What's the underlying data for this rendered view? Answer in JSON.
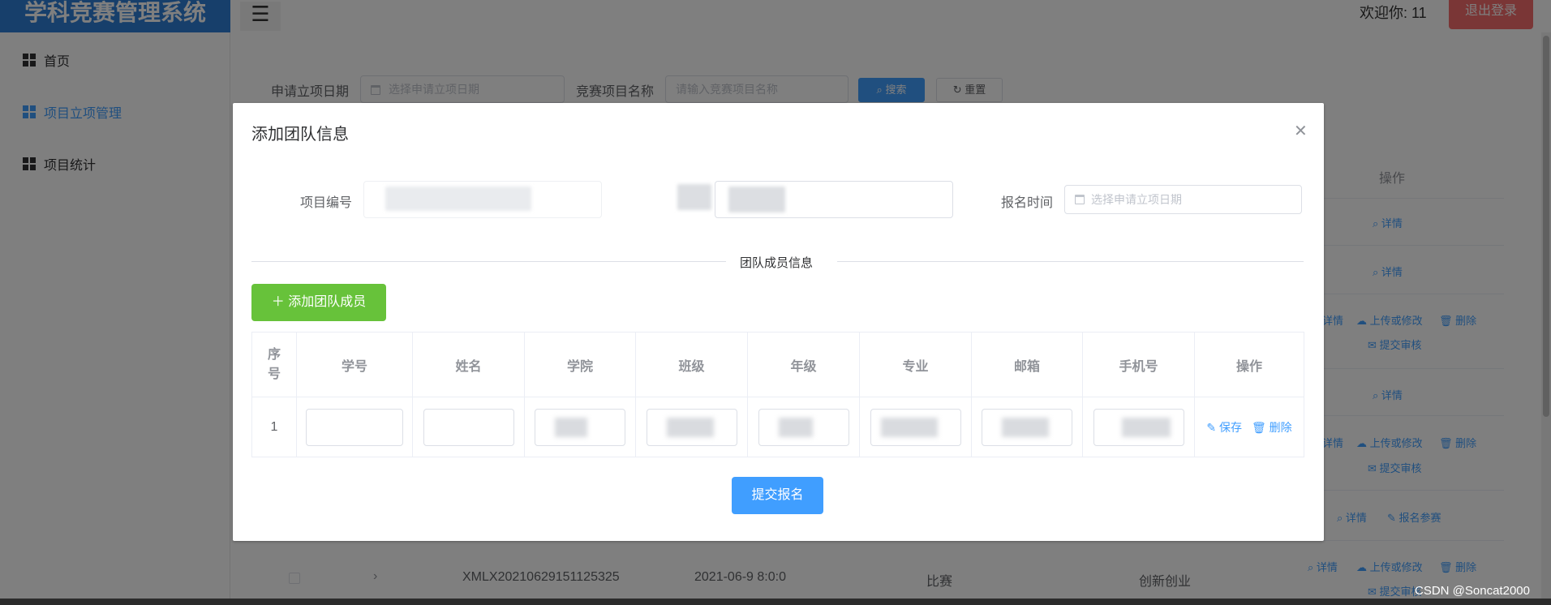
{
  "app": {
    "title": "学科竞赛管理系统",
    "welcome": "欢迎你: 11",
    "logout_label": "退出登录",
    "menu_icon": "hamburger-icon"
  },
  "sidebar": {
    "items": [
      {
        "label": "首页",
        "active": false
      },
      {
        "label": "项目立项管理",
        "active": true
      },
      {
        "label": "项目统计",
        "active": false
      }
    ]
  },
  "filters": {
    "date_label": "申请立项日期",
    "date_placeholder": "选择申请立项日期",
    "name_label": "竞赛项目名称",
    "name_placeholder": "请输入竞赛项目名称",
    "search_label": "搜索",
    "reset_label": "重置"
  },
  "background_table": {
    "operation_header": "操作",
    "actions": {
      "detail": "详情",
      "upload": "上传或修改",
      "delete": "删除",
      "submit_review": "提交审核",
      "register": "报名参赛"
    },
    "bottom_row": {
      "code": "XMLX20210629151125325",
      "date": "2021-06-9 8:0:0",
      "type": "比赛",
      "category": "创新创业"
    }
  },
  "dialog": {
    "title": "添加团队信息",
    "project_no_label": "项目编号",
    "signup_time_label": "报名时间",
    "signup_time_placeholder": "选择申请立项日期",
    "divider_text": "团队成员信息",
    "add_member_label": "添加团队成员",
    "submit_label": "提交报名",
    "table": {
      "headers": [
        "序号",
        "学号",
        "姓名",
        "学院",
        "班级",
        "年级",
        "专业",
        "邮箱",
        "手机号",
        "操作"
      ],
      "rows": [
        {
          "index": "1",
          "save": "保存",
          "delete": "删除"
        }
      ]
    }
  },
  "watermark": "CSDN @Soncat2000"
}
